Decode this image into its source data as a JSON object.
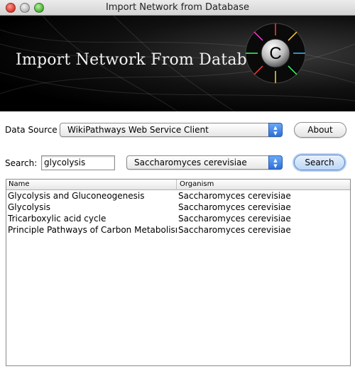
{
  "window": {
    "title": "Import Network from Database"
  },
  "banner": {
    "title": "Import Network From Database",
    "logo_letter": "C"
  },
  "datasource": {
    "label": "Data Source",
    "selected": "WikiPathways Web Service Client",
    "about_label": "About"
  },
  "search": {
    "label": "Search:",
    "value": "glycolysis",
    "organism_selected": "Saccharomyces cerevisiae",
    "button_label": "Search"
  },
  "results": {
    "columns": [
      "Name",
      "Organism"
    ],
    "rows": [
      [
        "Glycolysis and Gluconeogenesis",
        "Saccharomyces cerevisiae"
      ],
      [
        "Glycolysis",
        "Saccharomyces cerevisiae"
      ],
      [
        "Tricarboxylic acid cycle",
        "Saccharomyces cerevisiae"
      ],
      [
        "Principle Pathways of Carbon Metabolism",
        "Saccharomyces cerevisiae"
      ]
    ]
  },
  "colors": {
    "combo_arrow": "#2c6fd9",
    "default_button": "#bcd6f6",
    "banner_bg": "#000000"
  },
  "icons": [
    "close-icon",
    "minimize-icon",
    "maximize-icon",
    "cytoscape-logo-icon",
    "chevron-updown-icon"
  ]
}
